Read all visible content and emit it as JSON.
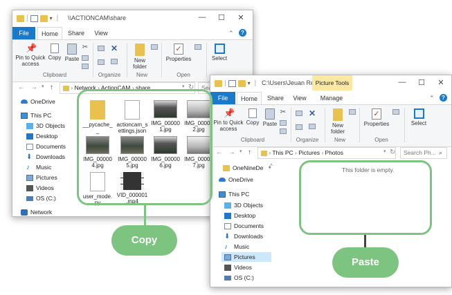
{
  "window1": {
    "title": "\\\\ACTIONCAM\\share",
    "tabs": [
      "File",
      "Home",
      "Share",
      "View"
    ],
    "ribbon": {
      "pin": "Pin to Quick access",
      "copy": "Copy",
      "paste": "Paste",
      "new_folder": "New folder",
      "properties": "Properties",
      "select": "Select",
      "groups": [
        "Clipboard",
        "Organize",
        "New",
        "Open"
      ]
    },
    "address": [
      "Network",
      "ActionCAM",
      "share"
    ],
    "search_placeholder": "Sea",
    "nav": [
      "OneDrive",
      "This PC",
      "3D Objects",
      "Desktop",
      "Documents",
      "Downloads",
      "Music",
      "Pictures",
      "Videos",
      "OS (C:)",
      "Network"
    ],
    "files": [
      {
        "name": "__pycache__",
        "kind": "folder"
      },
      {
        "name": "actioncam_settings.json",
        "kind": "doc"
      },
      {
        "name": "IMG_000001.jpg",
        "kind": "img"
      },
      {
        "name": "IMG_000002.jpg",
        "kind": "img"
      },
      {
        "name": "IMG_000004.jpg",
        "kind": "img"
      },
      {
        "name": "IMG_000005.jpg",
        "kind": "img"
      },
      {
        "name": "IMG_000006.jpg",
        "kind": "img"
      },
      {
        "name": "IMG_000007.jpg",
        "kind": "img"
      },
      {
        "name": "user_mode.py",
        "kind": "doc"
      },
      {
        "name": "VID_000001.mp4",
        "kind": "vid"
      }
    ]
  },
  "window2": {
    "title": "C:\\Users\\Jeuan Rees\\...",
    "context_tab": "Picture Tools",
    "tabs": [
      "File",
      "Home",
      "Share",
      "View",
      "Manage"
    ],
    "ribbon": {
      "pin": "Pin to Quick access",
      "copy": "Copy",
      "paste": "Paste",
      "new_folder": "New folder",
      "properties": "Properties",
      "select": "Select",
      "groups": [
        "Clipboard",
        "Organize",
        "New",
        "Open"
      ]
    },
    "address": [
      "This PC",
      "Pictures",
      "Photos"
    ],
    "search_placeholder": "Search Ph...",
    "nav": [
      "OneNineDe",
      "OneDrive",
      "This PC",
      "3D Objects",
      "Desktop",
      "Documents",
      "Downloads",
      "Music",
      "Pictures",
      "Videos",
      "OS (C:)"
    ],
    "empty_message": "This folder is empty."
  },
  "callouts": {
    "copy": "Copy",
    "paste": "Paste"
  },
  "colors": {
    "accent": "#1979ca",
    "callout": "#7dc481",
    "context_tab": "#fbe9a3"
  }
}
